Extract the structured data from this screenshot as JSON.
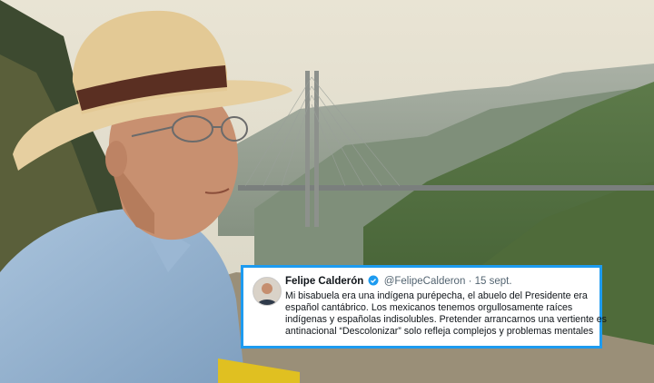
{
  "tweet": {
    "author_name": "Felipe Calderón",
    "handle": "@FelipeCalderon",
    "separator": "·",
    "date": "15 sept.",
    "verified_icon": "verified-badge-icon",
    "accent_color": "#1d9bf0",
    "text_lines": [
      "Mi bisabuela era una indígena purépecha, el abuelo del Presidente era",
      "español cantábrico. Los mexicanos tenemos orgullosamente raíces",
      "indígenas y españolas indisolubles. Pretender arrancarnos una vertiente es",
      "antinacional “Descolonizar” solo refleja complejos y problemas mentales"
    ]
  }
}
